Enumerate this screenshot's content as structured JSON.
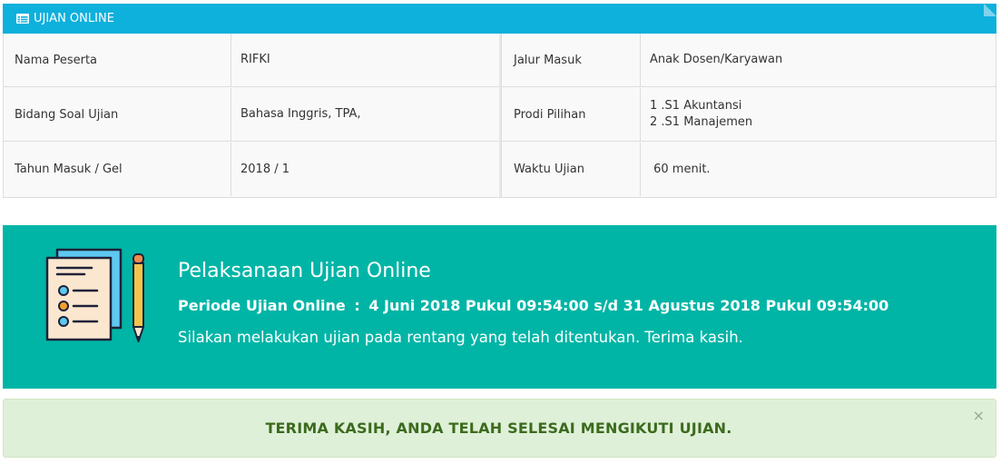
{
  "panel": {
    "title": "UJIAN ONLINE",
    "icon": "table-list-icon",
    "accent": "#0eb0dc"
  },
  "info": {
    "left": [
      {
        "label": "Nama Peserta",
        "value": [
          "RIFKI"
        ]
      },
      {
        "label": "Bidang Soal Ujian",
        "value": [
          "Bahasa Inggris, TPA,"
        ]
      },
      {
        "label": "Tahun Masuk / Gel",
        "value": [
          "2018 / 1"
        ]
      }
    ],
    "right": [
      {
        "label": "Jalur Masuk",
        "value": [
          "Anak Dosen/Karyawan"
        ]
      },
      {
        "label": "Prodi Pilihan",
        "value": [
          "1 .S1 Akuntansi",
          "2 .S1 Manajemen"
        ]
      },
      {
        "label": "Waktu Ujian",
        "value": [
          " 60 menit."
        ]
      }
    ]
  },
  "banner": {
    "title": "Pelaksanaan Ujian Online",
    "period_label": "Periode Ujian Online",
    "period_colon": ":",
    "period_value": "4 Juni 2018 Pukul 09:54:00 s/d 31 Agustus 2018 Pukul 09:54:00",
    "note": "Silakan melakukan ujian pada rentang yang telah ditentukan. Terima kasih.",
    "illustration_icon": "exam-checklist-pencil-icon",
    "background": "#00b5a6"
  },
  "alert": {
    "message": "TERIMA KASIH, ANDA TELAH SELESAI MENGIKUTI UJIAN.",
    "close_label": "×",
    "background": "#dff0d8",
    "text_color": "#3c6b1e"
  }
}
